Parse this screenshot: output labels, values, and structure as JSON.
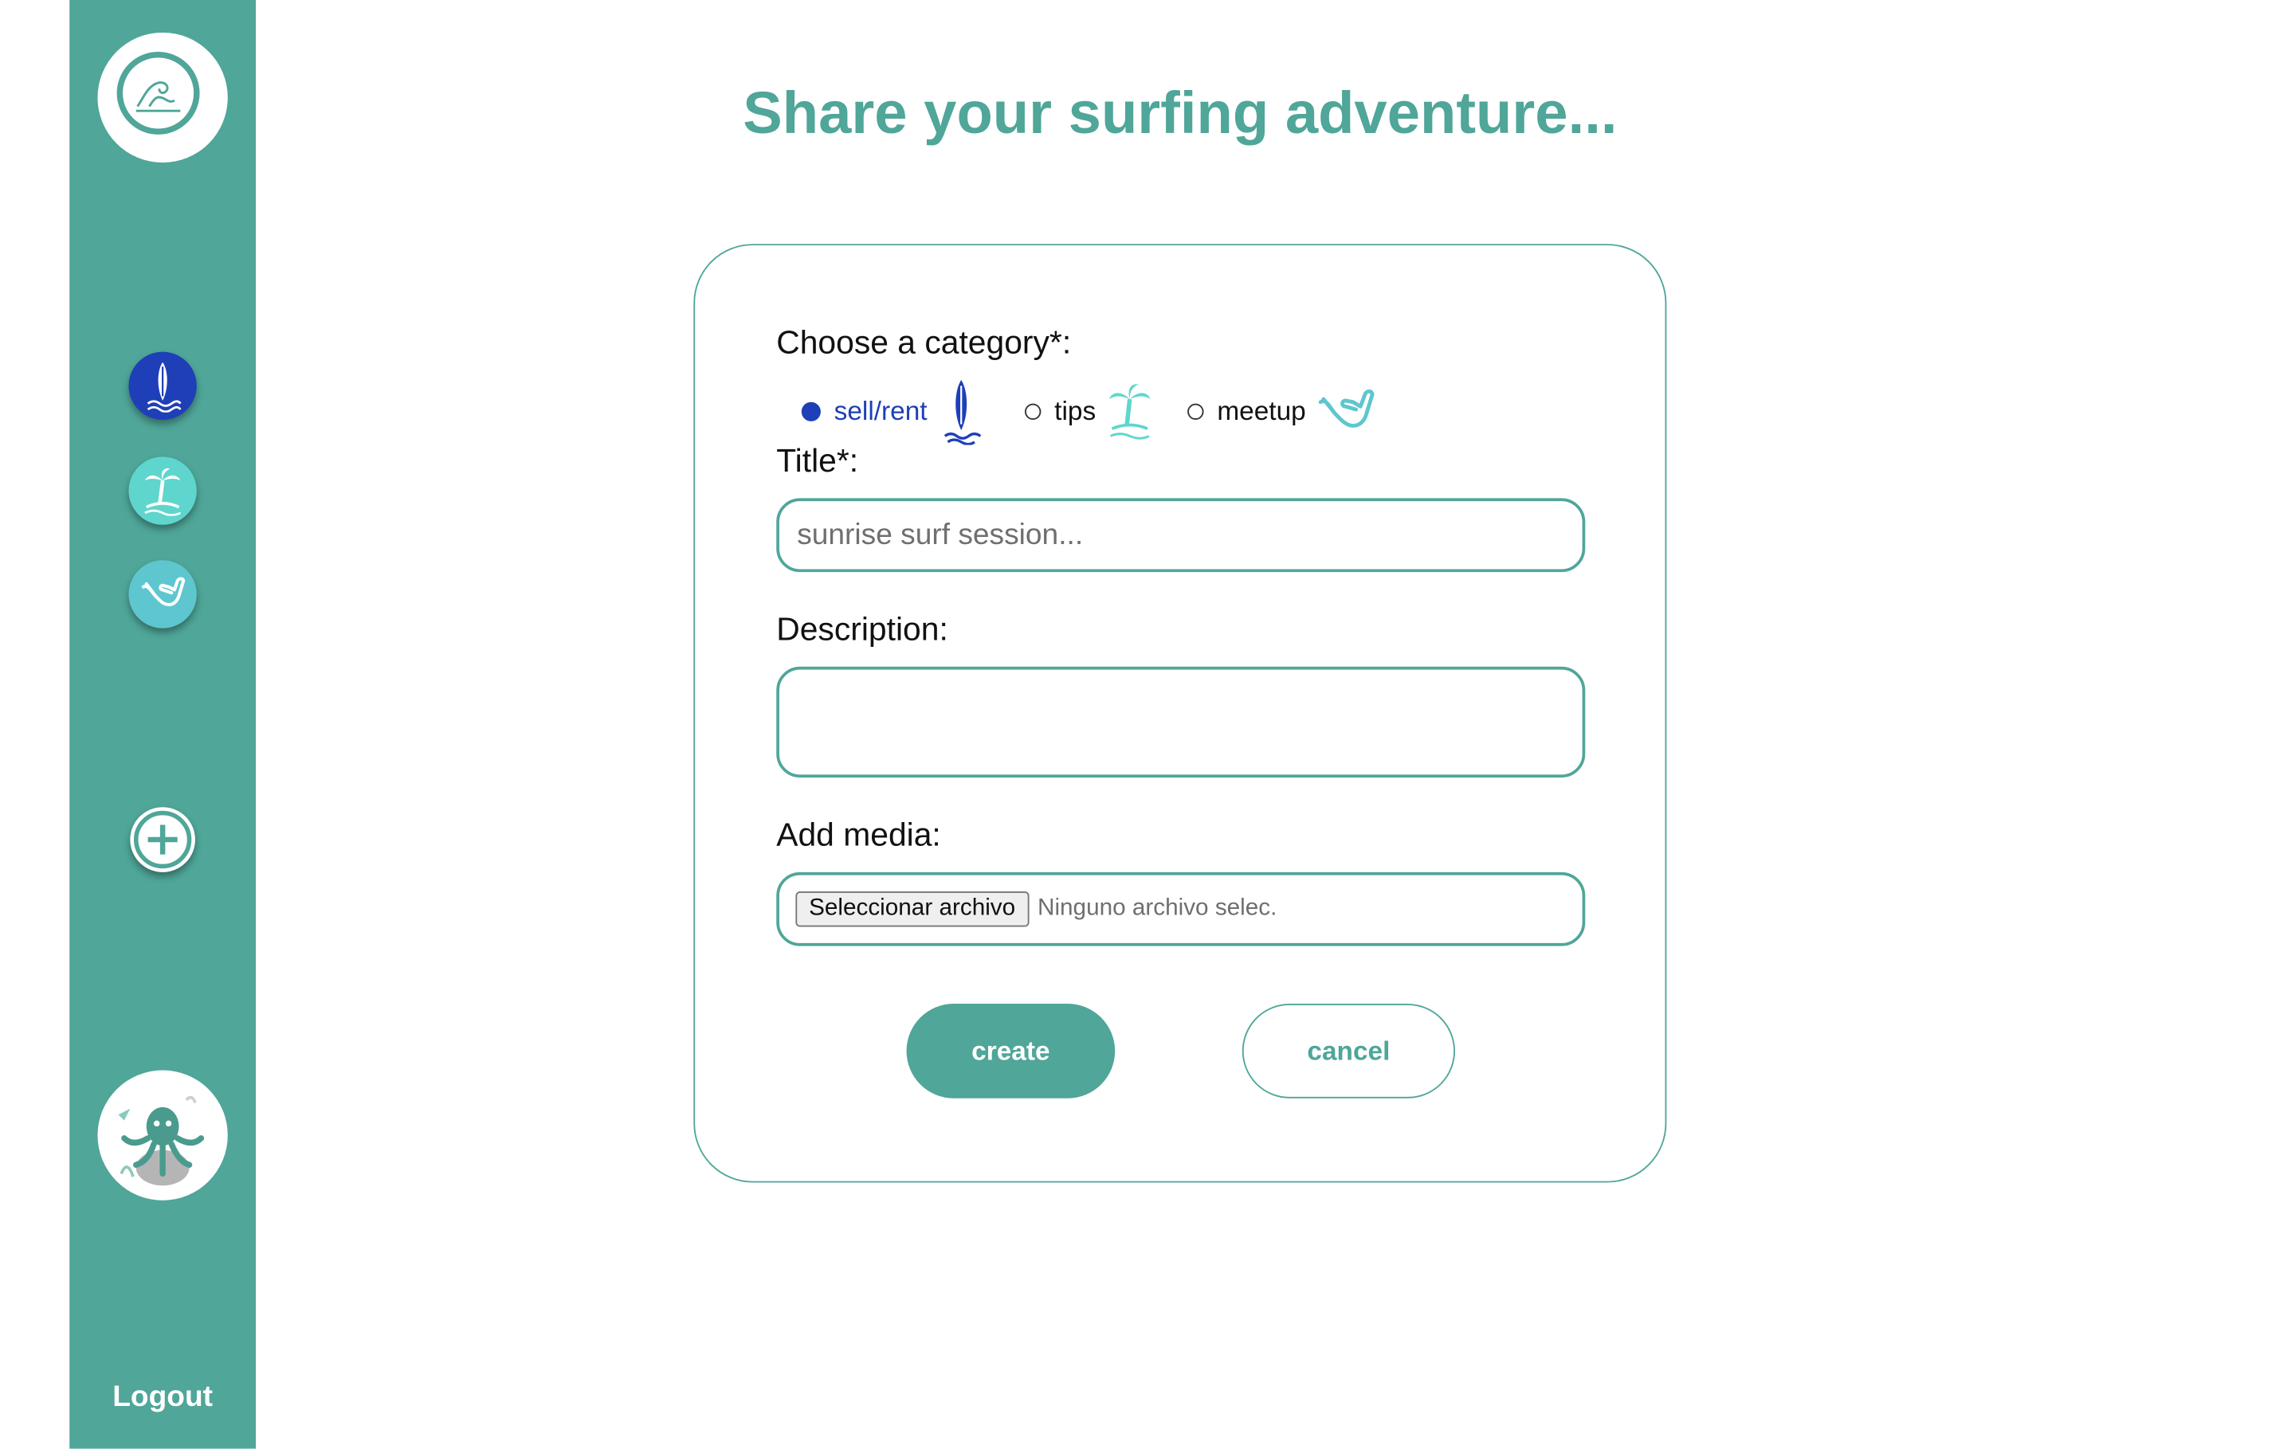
{
  "page": {
    "title": "Share your surfing adventure..."
  },
  "sidebar": {
    "logout_label": "Logout",
    "nav": [
      {
        "name": "sell-rent",
        "icon": "surfboard-icon",
        "color": "#1f3fb8"
      },
      {
        "name": "tips",
        "icon": "palm-tree-icon",
        "color": "#5fd6cd"
      },
      {
        "name": "meetup",
        "icon": "shaka-hand-icon",
        "color": "#5ec6cf"
      }
    ],
    "add_icon": "plus-icon",
    "logo_icon": "wave-icon",
    "avatar": "octopus-avatar"
  },
  "form": {
    "category_label": "Choose a category*:",
    "categories": [
      {
        "label": "sell/rent",
        "selected": true,
        "icon": "surfboard-icon"
      },
      {
        "label": "tips",
        "selected": false,
        "icon": "palm-tree-icon"
      },
      {
        "label": "meetup",
        "selected": false,
        "icon": "shaka-hand-icon"
      }
    ],
    "title_label": "Title*:",
    "title_placeholder": "sunrise surf session...",
    "description_label": "Description:",
    "description_value": "",
    "media_label": "Add media:",
    "file_button_label": "Seleccionar archivo",
    "file_status": "Ninguno archivo selec.",
    "create_label": "create",
    "cancel_label": "cancel"
  },
  "colors": {
    "accent": "#4fa699",
    "sell": "#1f3fb8",
    "tips": "#5fd6cd",
    "meetup": "#5ec6cf"
  }
}
